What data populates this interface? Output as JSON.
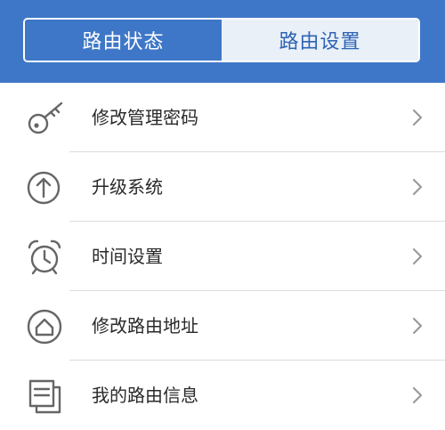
{
  "tabs": {
    "status": "路由状态",
    "settings": "路由设置"
  },
  "menu": [
    {
      "label": "修改管理密码",
      "icon": "key-icon"
    },
    {
      "label": "升级系统",
      "icon": "upgrade-arrow-icon"
    },
    {
      "label": "时间设置",
      "icon": "alarm-clock-icon"
    },
    {
      "label": "修改路由地址",
      "icon": "home-address-icon"
    },
    {
      "label": "我的路由信息",
      "icon": "router-info-icon"
    }
  ],
  "colors": {
    "header": "#3f77c8",
    "active_tab_text": "#ffffff",
    "inactive_tab_bg": "#e9f0f8",
    "inactive_tab_text": "#2e63b4"
  }
}
